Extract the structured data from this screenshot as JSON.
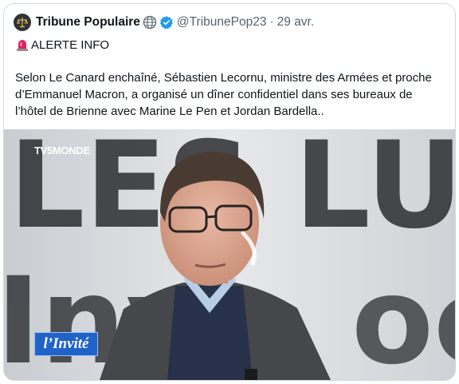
{
  "tweet": {
    "display_name": "Tribune Populaire",
    "handle": "@TribunePop23",
    "separator": "·",
    "date": "29 avr.",
    "alert": "ALERTE INFO",
    "body": "Selon Le Canard enchaîné, Sébastien Lecornu, ministre des Armées et proche d’Emmanuel Macron, a organisé un dîner confidentiel dans ses bureaux de l’hôtel de Brienne avec Marine Le Pen et Jordan Bardella.."
  },
  "media": {
    "channel_logo": "TV5MONDE",
    "lower_third": "l’Invité",
    "backdrop_letters_top": "LES LU",
    "backdrop_letters_bottom": "Inv"
  },
  "icons": {
    "avatar": "scales-of-justice-icon",
    "globe": "globe-icon",
    "verified": "verified-badge-icon",
    "alert": "rotating-light-icon"
  },
  "colors": {
    "verified": "#1d9bf0",
    "alert_red": "#e0245e",
    "muted_text": "#536471"
  }
}
